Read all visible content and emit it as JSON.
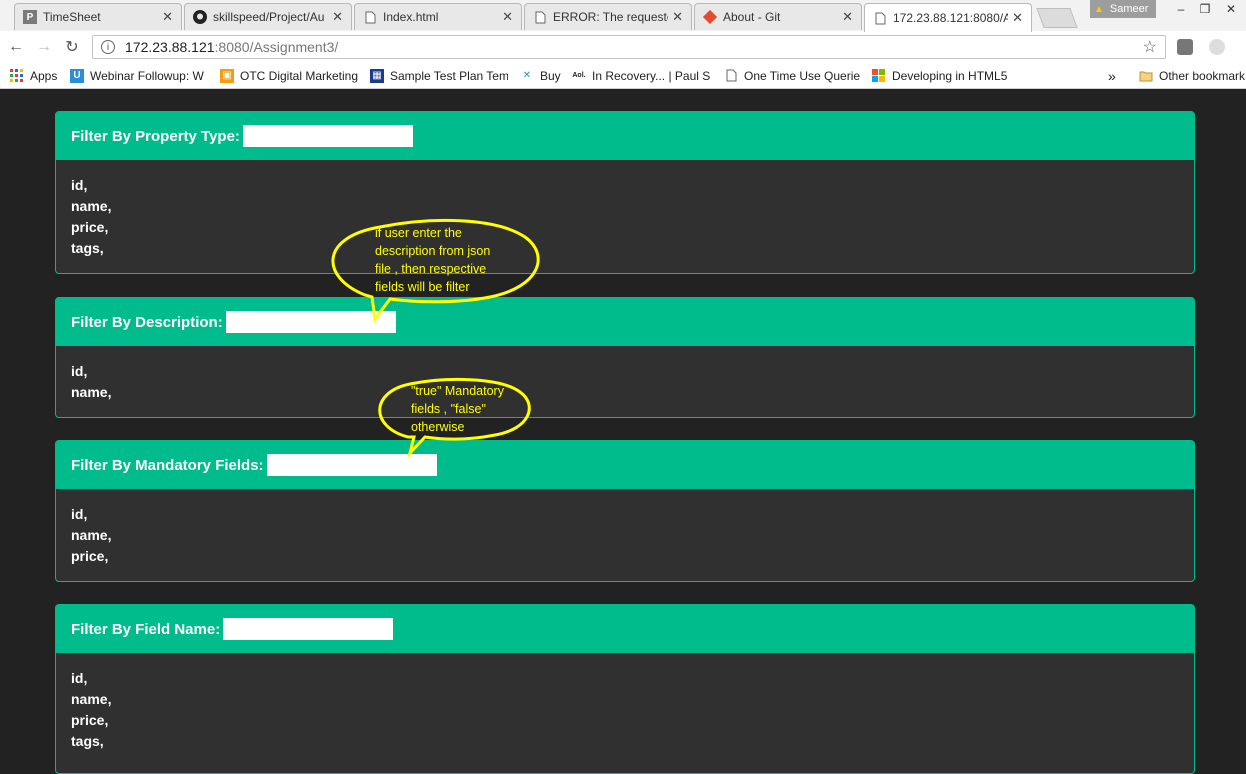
{
  "browser": {
    "tabs": [
      {
        "title": "TimeSheet",
        "icon": "timesheet-icon"
      },
      {
        "title": "skillspeed/Project/Au",
        "icon": "github-icon"
      },
      {
        "title": "Index.html",
        "icon": "page-icon"
      },
      {
        "title": "ERROR: The requeste",
        "icon": "page-icon"
      },
      {
        "title": "About - Git",
        "icon": "git-icon"
      },
      {
        "title": "172.23.88.121:8080/A",
        "icon": "page-icon"
      }
    ],
    "profile_name": "Sameer",
    "url_host": "172.23.88.121",
    "url_path": ":8080/Assignment3/",
    "bookmarks": [
      {
        "label": "Apps",
        "icon": "apps-grid-icon"
      },
      {
        "label": "Webinar Followup: W",
        "icon": "webinar-icon"
      },
      {
        "label": "OTC Digital Marketing",
        "icon": "otc-icon"
      },
      {
        "label": "Sample Test Plan Tem",
        "icon": "grid-doc-icon"
      },
      {
        "label": "Buy",
        "icon": "buy-icon"
      },
      {
        "label": "In Recovery... | Paul S",
        "icon": "aol-icon"
      },
      {
        "label": "One Time Use Querie",
        "icon": "page-icon"
      },
      {
        "label": "Developing in HTML5",
        "icon": "windows-icon"
      }
    ],
    "overflow_label": "»",
    "other_bookmarks": "Other bookmark"
  },
  "panels": [
    {
      "label": "Filter By Property Type:",
      "items": [
        "id,",
        "name,",
        "price,",
        "tags,"
      ]
    },
    {
      "label": "Filter By Description:",
      "items": [
        "id,",
        "name,"
      ]
    },
    {
      "label": "Filter By Mandatory Fields:",
      "items": [
        "id,",
        "name,",
        "price,"
      ]
    },
    {
      "label": "Filter By Field Name:",
      "items": [
        "id,",
        "name,",
        "price,",
        "tags,"
      ]
    }
  ],
  "callouts": [
    {
      "lines": [
        "if user enter the",
        "description from json",
        "file , then respective",
        "fields will be filter"
      ]
    },
    {
      "lines": [
        "\"true\" Mandatory",
        "fields , \"false\"",
        "otherwise"
      ]
    }
  ],
  "colors": {
    "accent": "#00bc8c",
    "panel_body": "#303030",
    "page_bg": "#222222",
    "callout": "#ffff00"
  }
}
